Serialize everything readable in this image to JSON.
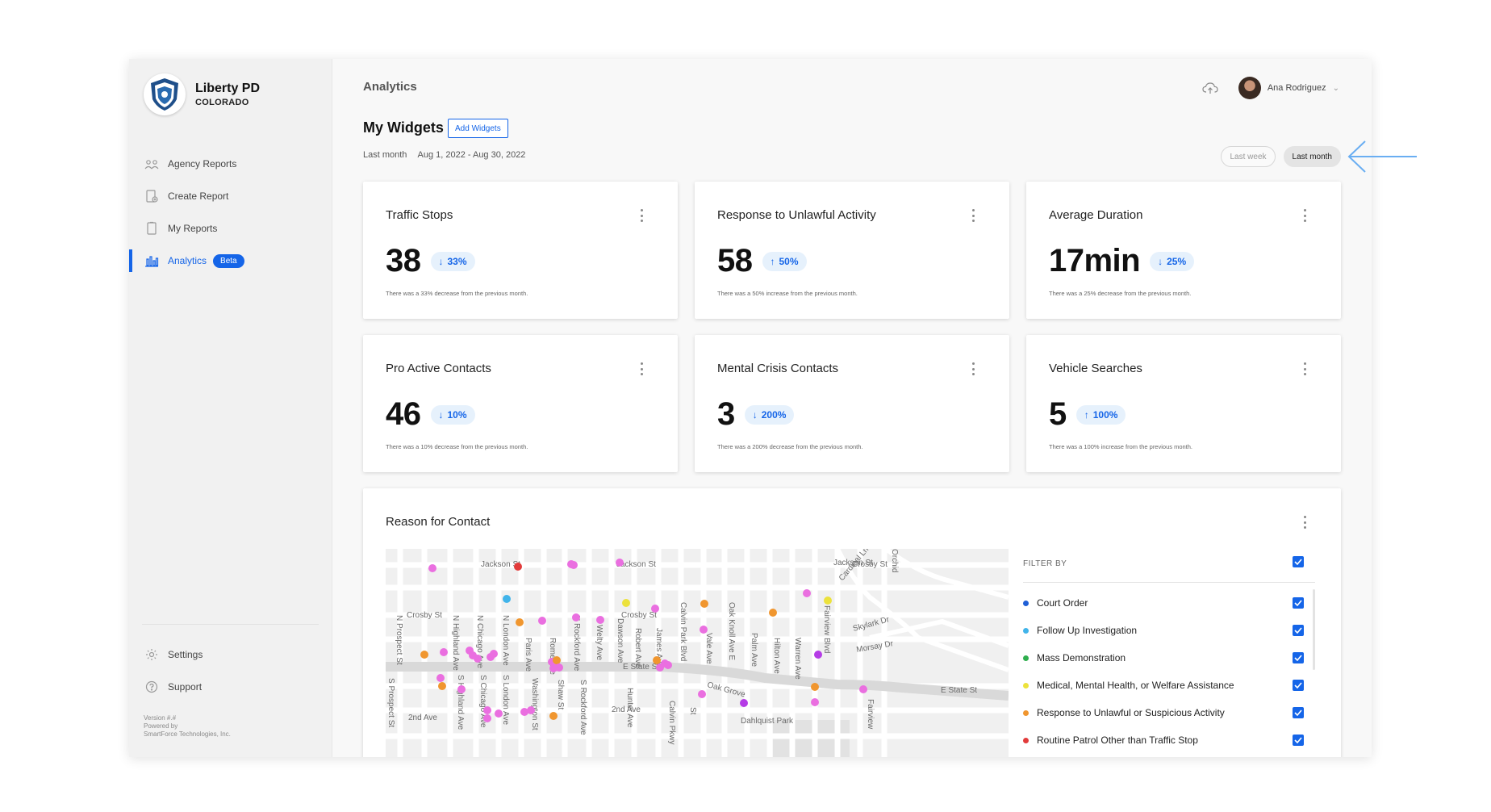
{
  "brand": {
    "name": "Liberty PD",
    "sub": "COLORADO"
  },
  "nav": [
    {
      "label": "Agency Reports",
      "icon": "agency-reports-icon"
    },
    {
      "label": "Create Report",
      "icon": "create-report-icon"
    },
    {
      "label": "My Reports",
      "icon": "my-reports-icon"
    },
    {
      "label": "Analytics",
      "icon": "analytics-icon",
      "badge": "Beta",
      "active": true
    }
  ],
  "bottom_nav": [
    {
      "label": "Settings",
      "icon": "gear-icon"
    },
    {
      "label": "Support",
      "icon": "help-icon"
    }
  ],
  "version": {
    "line1": "Version #.#",
    "line2": "Powered by",
    "line3": "SmartForce Technologies, Inc."
  },
  "header": {
    "title": "Analytics",
    "user": "Ana Rodriguez"
  },
  "widgets": {
    "title": "My Widgets",
    "add_label": "Add Widgets",
    "range_label": "Last month",
    "range_dates": "Aug 1, 2022 - Aug 30, 2022",
    "toggle": [
      "Last week",
      "Last month"
    ],
    "toggle_selected": "Last month"
  },
  "cards": [
    {
      "title": "Traffic Stops",
      "value": "38",
      "arrow": "↓",
      "change": "33%",
      "note": "There was a 33% decrease from the previous month."
    },
    {
      "title": "Response to Unlawful Activity",
      "value": "58",
      "arrow": "↑",
      "change": "50%",
      "note": "There was a 50% increase from the previous month."
    },
    {
      "title": "Average Duration",
      "value": "17min",
      "arrow": "↓",
      "change": "25%",
      "note": "There was a 25% decrease from the previous month."
    },
    {
      "title": "Pro Active Contacts",
      "value": "46",
      "arrow": "↓",
      "change": "10%",
      "note": "There was a 10% decrease from the previous month."
    },
    {
      "title": "Mental Crisis Contacts",
      "value": "3",
      "arrow": "↓",
      "change": "200%",
      "note": "There was a 200% decrease from the previous month."
    },
    {
      "title": "Vehicle Searches",
      "value": "5",
      "arrow": "↑",
      "change": "100%",
      "note": "There was a 100% increase from the previous month."
    }
  ],
  "map": {
    "title": "Reason for Contact",
    "street_labels": [
      "Jackson St",
      "Jackson St",
      "Jackson St",
      "Crosby St",
      "Crosby St",
      "Crosby St",
      "E State St",
      "E State St",
      "N Prospect St",
      "N Highland Ave",
      "N Chicago Ave",
      "N London Ave",
      "Paris Ave",
      "Rome Ave",
      "N Rockford Ave",
      "Welty Ave",
      "Dawson Ave",
      "Robert Ave",
      "James Ave",
      "Calvin Park Blvd",
      "Oak Knoll Ave E",
      "Vale Ave",
      "Palm Ave",
      "Hilton Ave",
      "Warren Ave",
      "Fairview Blvd",
      "Cardinal Ln",
      "Skylark Dr",
      "Morsay Dr",
      "Oak Grove",
      "S Prospect St",
      "S Highland Ave",
      "S Chicago Ave",
      "S London Ave",
      "Washington St",
      "Shaw St",
      "S Rockford Ave",
      "2nd Ave",
      "2nd Ave",
      "Hunter Ave",
      "Dahlquist Park",
      "Calvin Pkwy",
      "St",
      "Fairview",
      "Orchid"
    ]
  },
  "filter": {
    "label": "FILTER BY",
    "items": [
      {
        "label": "Court Order",
        "color": "#1f5fd6"
      },
      {
        "label": "Follow Up Investigation",
        "color": "#41b4ea"
      },
      {
        "label": "Mass Demonstration",
        "color": "#2fae4e"
      },
      {
        "label": "Medical, Mental Health, or Welfare Assistance",
        "color": "#ece23c"
      },
      {
        "label": "Response to Unlawful or Suspicious Activity",
        "color": "#f0962f"
      },
      {
        "label": "Routine Patrol Other than Traffic Stop",
        "color": "#e23b3b"
      }
    ]
  },
  "colors": {
    "accent": "#1565e8",
    "sidebar": "#f1f1f1",
    "marker_pink": "#ea6fe0",
    "marker_purple": "#b53ce6"
  }
}
